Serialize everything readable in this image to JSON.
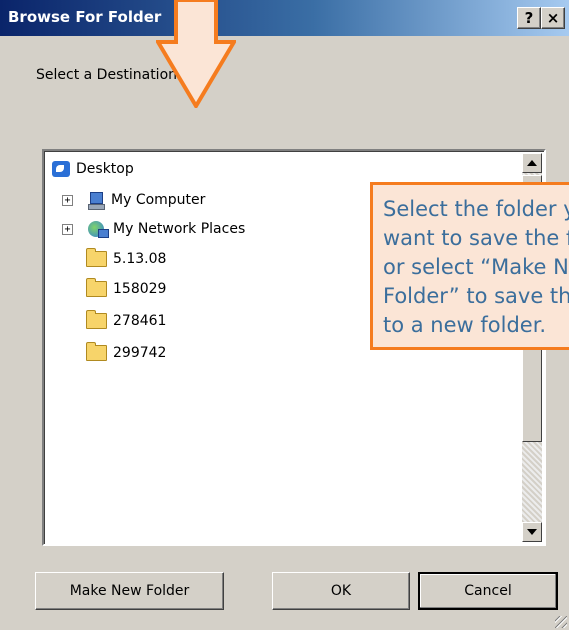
{
  "window": {
    "title": "Browse For Folder",
    "help_label": "?",
    "close_label": "×"
  },
  "prompt": "Select a Destination",
  "tree": {
    "items": [
      {
        "label": "Desktop",
        "icon": "desktop-icon"
      },
      {
        "label": "My Computer",
        "icon": "my-computer-icon",
        "expander": "+"
      },
      {
        "label": "My Network Places",
        "icon": "network-places-icon",
        "expander": "+"
      },
      {
        "label": "5.13.08",
        "icon": "folder-icon"
      },
      {
        "label": "158029",
        "icon": "folder-icon"
      },
      {
        "label": "278461",
        "icon": "folder-icon"
      },
      {
        "label": "299742",
        "icon": "folder-icon"
      }
    ]
  },
  "buttons": {
    "make_new_folder": "Make New Folder",
    "ok": "OK",
    "cancel": "Cancel"
  },
  "callout": {
    "lines": [
      "Select the folder you",
      "want to save the files to",
      "or select “Make New",
      "Folder” to save the files",
      "to a new folder."
    ]
  },
  "colors": {
    "callout_border": "#f57c1f",
    "callout_fill": "#fbe5d6",
    "callout_text": "#3b6e9c",
    "arrow_fill": "#fbe5d6",
    "arrow_stroke": "#f57c1f"
  }
}
